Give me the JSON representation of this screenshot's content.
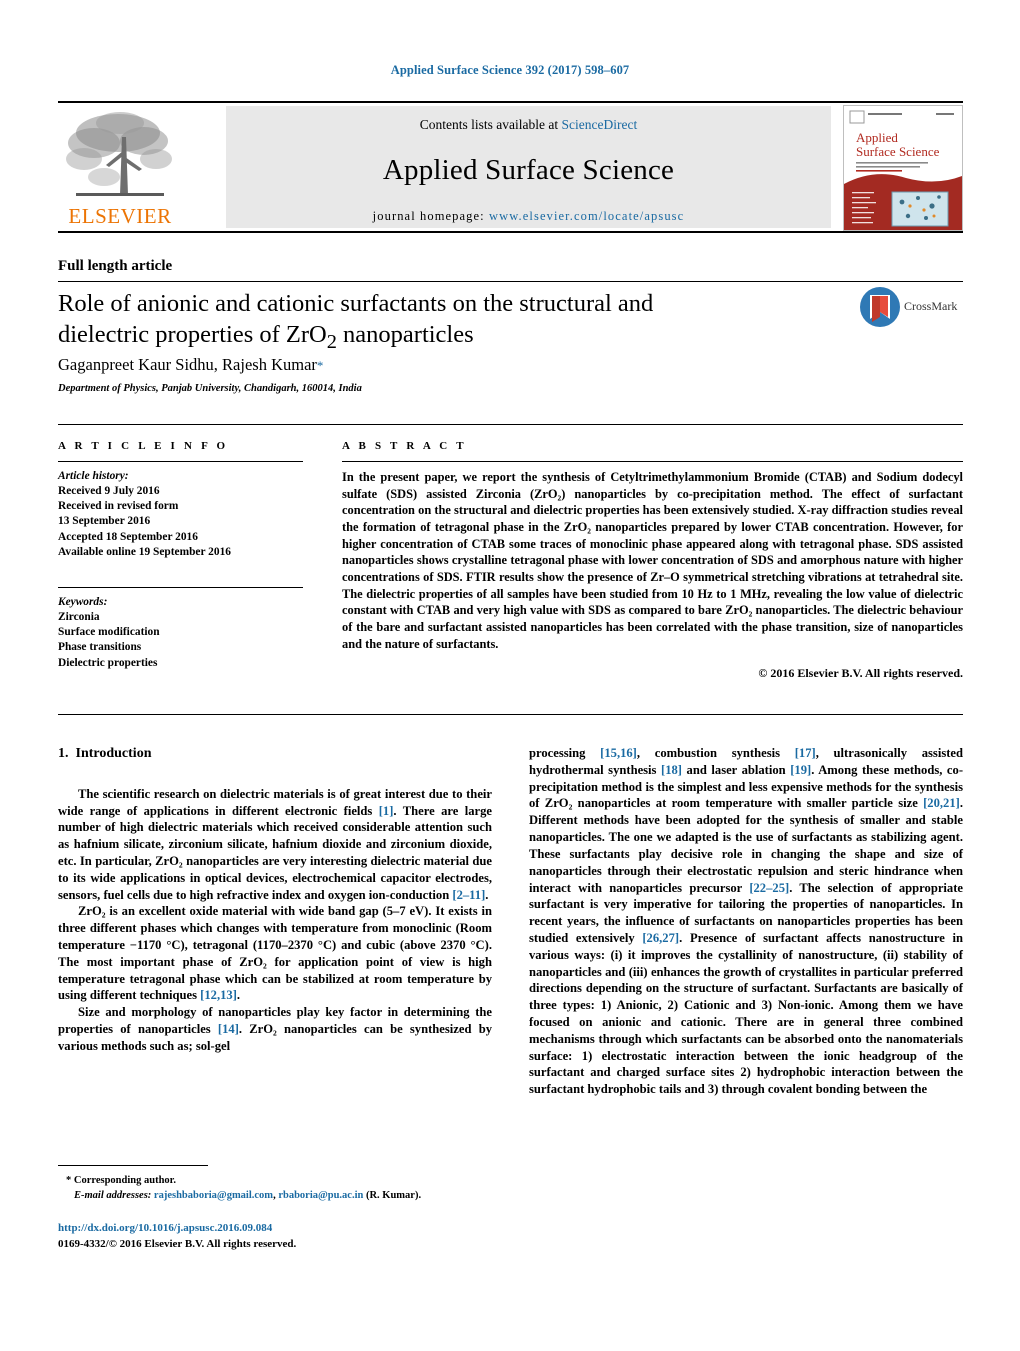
{
  "running_head": "Applied Surface Science 392 (2017) 598–607",
  "masthead": {
    "contents_prefix": "Contents lists available at ",
    "sciencedirect": "ScienceDirect",
    "journal_name": "Applied Surface Science",
    "homepage_prefix": "journal homepage: ",
    "homepage_url": "www.elsevier.com/locate/apsusc",
    "publisher": "ELSEVIER",
    "cover_title_line1": "Applied",
    "cover_title_line2": "Surface Science",
    "accent_color": "#1a6aa2",
    "publisher_color": "#ec7404"
  },
  "article": {
    "type": "Full length article",
    "title": "Role of anionic and cationic surfactants on the structural and dielectric properties of ZrO₂ nanoparticles",
    "title_line1": "Role of anionic and cationic surfactants on the structural and",
    "title_line2_a": "dielectric properties of ZrO",
    "title_line2_sub": "2",
    "title_line2_b": " nanoparticles",
    "authors": "Gaganpreet Kaur Sidhu, Rajesh Kumar",
    "corresponding_mark": "*",
    "affiliation": "Department of Physics, Panjab University, Chandigarh, 160014, India",
    "crossmark_label": "CrossMark"
  },
  "info": {
    "heading": "A R T I C L E   I N F O",
    "history_label": "Article history:",
    "history": [
      "Received 9 July 2016",
      "Received in revised form",
      "13 September 2016",
      "Accepted 18 September 2016",
      "Available online 19 September 2016"
    ],
    "keywords_label": "Keywords:",
    "keywords": [
      "Zirconia",
      "Surface modification",
      "Phase transitions",
      "Dielectric properties"
    ]
  },
  "abstract": {
    "heading": "A B S T R A C T",
    "text": "In the present paper, we report the synthesis of Cetyltrimethylammonium Bromide (CTAB) and Sodium dodecyl sulfate (SDS) assisted Zirconia (ZrO₂) nanoparticles by co-precipitation method. The effect of surfactant concentration on the structural and dielectric properties has been extensively studied. X-ray diffraction studies reveal the formation of tetragonal phase in the ZrO₂ nanoparticles prepared by lower CTAB concentration. However, for higher concentration of CTAB some traces of monoclinic phase appeared along with tetragonal phase. SDS assisted nanoparticles shows crystalline tetragonal phase with lower concentration of SDS and amorphous nature with higher concentrations of SDS. FTIR results show the presence of Zr–O symmetrical stretching vibrations at tetrahedral site. The dielectric properties of all samples have been studied from 10 Hz to 1 MHz, revealing the low value of dielectric constant with CTAB and very high value with SDS as compared to bare ZrO₂ nanoparticles. The dielectric behaviour of the bare and surfactant assisted nanoparticles has been correlated with the phase transition, size of nanoparticles and the nature of surfactants.",
    "copyright": "© 2016 Elsevier B.V. All rights reserved."
  },
  "body": {
    "section_number": "1.",
    "section_title": "Introduction",
    "left_para1_a": "The scientific research on dielectric materials is of great interest due to their wide range of applications in different electronic fields ",
    "left_para1_ref1": "[1]",
    "left_para1_b": ". There are large number of high dielectric materials which received considerable attention such as hafnium silicate, zirconium silicate, hafnium dioxide and zirconium dioxide, etc. In particular, ZrO₂ nanoparticles are very interesting dielectric material due to its wide applications in optical devices, electrochemical capacitor electrodes, sensors, fuel cells due to high refractive index and oxygen ion-conduction ",
    "left_para1_ref2": "[2–11]",
    "left_para1_c": ".",
    "left_para2_a": "ZrO₂ is an excellent oxide material with wide band gap (5–7 eV). It exists in three different phases which changes with temperature from monoclinic (Room temperature −1170 °C), tetragonal (1170–2370 °C) and cubic (above 2370 °C). The most important phase of ZrO₂ for application point of view is high temperature tetragonal phase which can be stabilized at room temperature by using different techniques ",
    "left_para2_ref": "[12,13]",
    "left_para2_b": ".",
    "left_para3_a": "Size and morphology of nanoparticles play key factor in determining the properties of nanoparticles ",
    "left_para3_ref": "[14]",
    "left_para3_b": ". ZrO₂ nanoparticles can be synthesized by various methods such as; sol-gel",
    "right_para1_a": "processing ",
    "right_para1_ref1": "[15,16]",
    "right_para1_b": ", combustion synthesis ",
    "right_para1_ref2": "[17]",
    "right_para1_c": ", ultrasonically assisted hydrothermal synthesis ",
    "right_para1_ref3": "[18]",
    "right_para1_d": " and laser ablation ",
    "right_para1_ref4": "[19]",
    "right_para1_e": ". Among these methods, co-precipitation method is the simplest and less expensive methods for the synthesis of ZrO₂ nanoparticles at room temperature with smaller particle size ",
    "right_para1_ref5": "[20,21]",
    "right_para1_f": ". Different methods have been adopted for the synthesis of smaller and stable nanoparticles. The one we adapted is the use of surfactants as stabilizing agent. These surfactants play decisive role in changing the shape and size of nanoparticles through their electrostatic repulsion and steric hindrance when interact with nanoparticles precursor ",
    "right_para1_ref6": "[22–25]",
    "right_para1_g": ". The selection of appropriate surfactant is very imperative for tailoring the properties of nanoparticles. In recent years, the influence of surfactants on nanoparticles properties has been studied extensively ",
    "right_para1_ref7": "[26,27]",
    "right_para1_h": ". Presence of surfactant affects nanostructure in various ways: (i) it improves the cystallinity of nanostructure, (ii) stability of nanoparticles and (iii) enhances the growth of crystallites in particular preferred directions depending on the structure of surfactant. Surfactants are basically of three types: 1) Anionic, 2) Cationic and 3) Non-ionic. Among them we have focused on anionic and cationic. There are in general three combined mechanisms through which surfactants can be absorbed onto the nanomaterials surface: 1) electrostatic interaction between the ionic headgroup of the surfactant and charged surface sites 2) hydrophobic interaction between the surfactant hydrophobic tails and 3) through covalent bonding between the"
  },
  "footer": {
    "corresponding_star": "*",
    "corresponding_label": "Corresponding author.",
    "email_label": "E-mail addresses:",
    "email1": "rajeshbaboria@gmail.com",
    "email_sep": ", ",
    "email2": "rbaboria@pu.ac.in",
    "email_owner": " (R. Kumar).",
    "doi": "http://dx.doi.org/10.1016/j.apsusc.2016.09.084",
    "issn_line": "0169-4332/© 2016 Elsevier B.V. All rights reserved."
  }
}
